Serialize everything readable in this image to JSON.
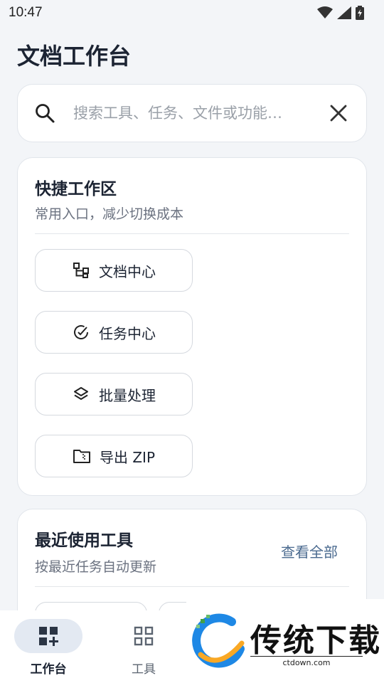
{
  "status_bar": {
    "time": "10:47"
  },
  "header": {
    "title": "文档工作台"
  },
  "search": {
    "placeholder": "搜索工具、任务、文件或功能…",
    "value": ""
  },
  "quick": {
    "title": "快捷工作区",
    "subtitle": "常用入口，减少切换成本",
    "buttons": [
      {
        "label": "文档中心",
        "icon": "hierarchy-icon"
      },
      {
        "label": "任务中心",
        "icon": "check-circle-icon"
      },
      {
        "label": "批量处理",
        "icon": "layers-icon"
      },
      {
        "label": "导出 ZIP",
        "icon": "folder-zip-icon"
      }
    ]
  },
  "recent": {
    "title": "最近使用工具",
    "subtitle": "按最近任务自动更新",
    "view_all": "查看全部"
  },
  "bottom_nav": {
    "items": [
      {
        "label": "工作台",
        "icon": "dashboard-add-icon",
        "active": true
      },
      {
        "label": "工具",
        "icon": "grid-icon",
        "active": false
      }
    ]
  },
  "watermark": {
    "brand": "传统下载",
    "url": "ctdown.com"
  },
  "colors": {
    "accent": "#4a6a8f",
    "nav_active_bg": "#e3e9f2",
    "background": "#f3f5f8"
  }
}
